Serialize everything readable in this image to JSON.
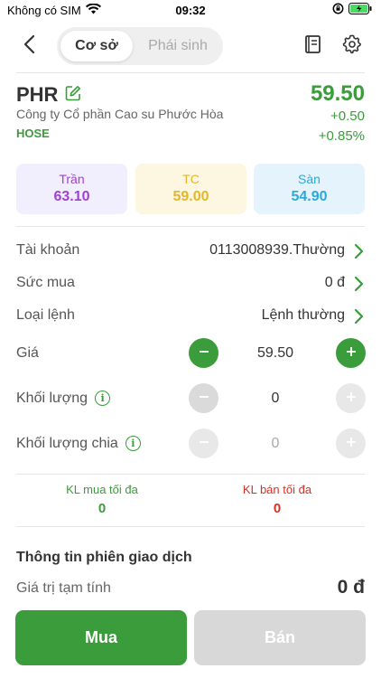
{
  "status_bar": {
    "carrier": "Không có SIM",
    "time": "09:32"
  },
  "nav": {
    "tabs": [
      {
        "label": "Cơ sở",
        "active": true
      },
      {
        "label": "Phái sinh",
        "active": false
      }
    ]
  },
  "stock": {
    "symbol": "PHR",
    "company": "Công ty Cổ phần Cao su Phước Hòa",
    "exchange": "HOSE",
    "price": "59.50",
    "change": "+0.50",
    "change_pct": "+0.85%"
  },
  "ref_prices": {
    "ceiling": {
      "label": "Trần",
      "value": "63.10",
      "color": "#a23fd6",
      "bg": "#f1eefe"
    },
    "reference": {
      "label": "TC",
      "value": "59.00",
      "color": "#e6b52a",
      "bg": "#fdf7e2"
    },
    "floor": {
      "label": "Sàn",
      "value": "54.90",
      "color": "#2ea8d9",
      "bg": "#e5f3fc"
    }
  },
  "form": {
    "account_label": "Tài khoản",
    "account_value": "0113008939.Thường",
    "buying_power_label": "Sức mua",
    "buying_power_value": "0 đ",
    "order_type_label": "Loại lệnh",
    "order_type_value": "Lệnh thường",
    "price_label": "Giá",
    "price_value": "59.50",
    "volume_label": "Khối lượng",
    "volume_value": "0",
    "split_volume_label": "Khối lượng chia",
    "split_volume_value": "0"
  },
  "max": {
    "buy_label": "KL mua tối đa",
    "buy_value": "0",
    "sell_label": "KL bán tối đa",
    "sell_value": "0"
  },
  "session": {
    "title": "Thông tin phiên giao dịch",
    "estimate_label": "Giá trị tạm tính",
    "estimate_value": "0 đ"
  },
  "actions": {
    "buy_label": "Mua",
    "sell_label": "Bán"
  },
  "colors": {
    "accent_green": "#3a9c3a",
    "sell_red": "#d93025"
  },
  "icons": [
    "wifi-icon",
    "lock-rotation-icon",
    "battery-icon",
    "back-arrow-icon",
    "book-icon",
    "gear-icon",
    "edit-icon",
    "chevron-right-icon",
    "minus-icon",
    "plus-icon",
    "info-icon"
  ]
}
